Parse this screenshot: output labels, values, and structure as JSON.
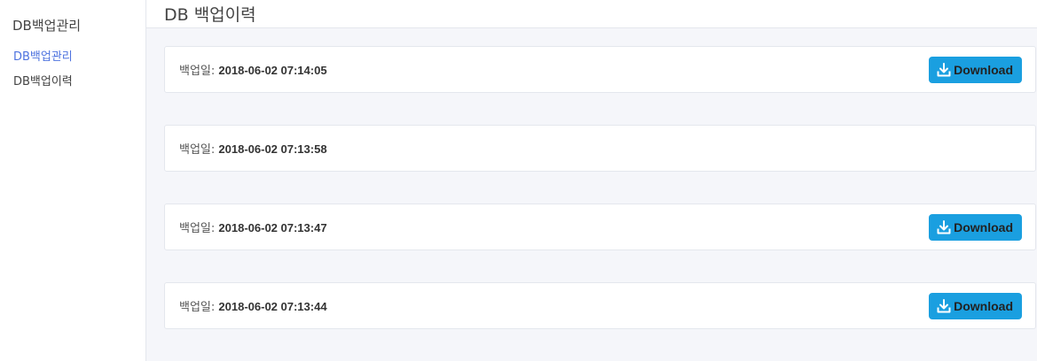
{
  "sidebar": {
    "title": "DB백업관리",
    "items": [
      {
        "label": "DB백업관리",
        "active": true
      },
      {
        "label": "DB백업이력",
        "active": false
      }
    ]
  },
  "header": {
    "title": "DB 백업이력"
  },
  "backups": [
    {
      "label": "백업일:",
      "date": "2018-06-02 07:14:05",
      "download_label": "Download",
      "has_download": true
    },
    {
      "label": "백업일:",
      "date": "2018-06-02 07:13:58",
      "download_label": "",
      "has_download": false
    },
    {
      "label": "백업일:",
      "date": "2018-06-02 07:13:47",
      "download_label": "Download",
      "has_download": true
    },
    {
      "label": "백업일:",
      "date": "2018-06-02 07:13:44",
      "download_label": "Download",
      "has_download": true
    }
  ],
  "colors": {
    "accent": "#4e73df",
    "download_button": "#1a9fe0",
    "background": "#f5f6fa"
  },
  "icons": {
    "download": "download-icon"
  }
}
